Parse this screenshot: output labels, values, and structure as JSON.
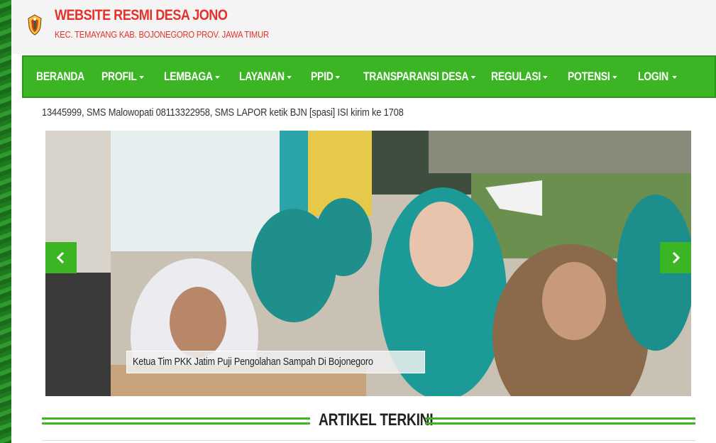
{
  "header": {
    "title": "WEBSITE RESMI DESA JONO",
    "subtitle": "KEC. TEMAYANG KAB. BOJONEGORO PROV. JAWA TIMUR",
    "logo_icon": "regency-crest-icon"
  },
  "nav": {
    "items": [
      {
        "label": "BERANDA",
        "dropdown": false
      },
      {
        "label": "PROFIL",
        "dropdown": true
      },
      {
        "label": "LEMBAGA",
        "dropdown": true
      },
      {
        "label": "LAYANAN",
        "dropdown": true
      },
      {
        "label": "PPID",
        "dropdown": true
      },
      {
        "label": "TRANSPARANSI DESA",
        "dropdown": true
      },
      {
        "label": "REGULASI",
        "dropdown": true
      },
      {
        "label": "POTENSI",
        "dropdown": true
      },
      {
        "label": "LOGIN",
        "dropdown": true
      }
    ]
  },
  "ticker": {
    "text": "13445999, SMS Malowopati 08113322958, SMS LAPOR ketik BJN [spasi] ISI kirim ke 1708"
  },
  "slider": {
    "caption": "Ketua Tim PKK Jatim Puji Pengolahan Sampah Di Bojonegoro",
    "prev_icon": "chevron-left-icon",
    "next_icon": "chevron-right-icon"
  },
  "section": {
    "title": "ARTIKEL TERKINI"
  },
  "colors": {
    "brand_green": "#3cb524",
    "title_red": "#e3322b",
    "background_green": "#2e8b2e"
  }
}
